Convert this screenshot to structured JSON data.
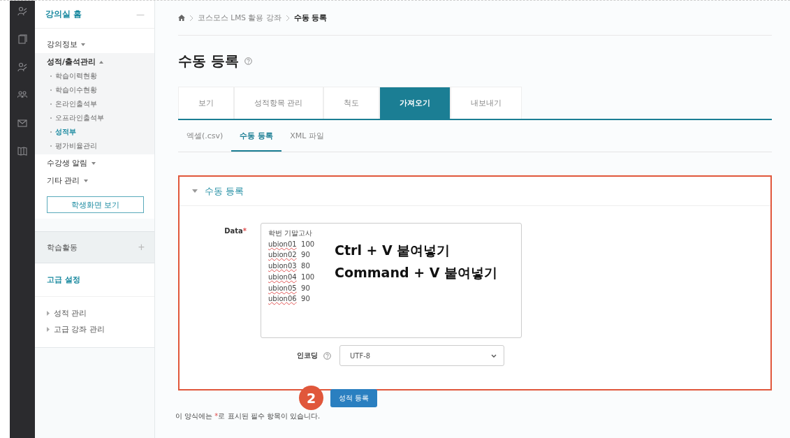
{
  "sidebar": {
    "home": {
      "label": "강의실 홈",
      "collapse_symbol": "—"
    },
    "menu": [
      {
        "label": "강의정보",
        "expanded": false
      },
      {
        "label": "성적/출석관리",
        "expanded": true,
        "children": [
          {
            "label": "학습이력현황",
            "selected": false
          },
          {
            "label": "학습이수현황",
            "selected": false
          },
          {
            "label": "온라인출석부",
            "selected": false
          },
          {
            "label": "오프라인출석부",
            "selected": false
          },
          {
            "label": "성적부",
            "selected": true
          },
          {
            "label": "평가비율관리",
            "selected": false
          }
        ]
      },
      {
        "label": "수강생 알림",
        "expanded": false
      },
      {
        "label": "기타 관리",
        "expanded": false
      }
    ],
    "student_view_button": "학생화면 보기",
    "activity": {
      "label": "학습활동",
      "add_symbol": "+"
    },
    "advanced": {
      "label": "고급 설정",
      "items": [
        "성적 관리",
        "고급 강좌 관리"
      ]
    }
  },
  "breadcrumb": [
    "코스모스 LMS 활용 강좌",
    "수동 등록"
  ],
  "title": "수동 등록",
  "tabs": [
    {
      "label": "보기",
      "selected": false
    },
    {
      "label": "성적항목 관리",
      "selected": false
    },
    {
      "label": "척도",
      "selected": false
    },
    {
      "label": "가져오기",
      "selected": true
    },
    {
      "label": "내보내기",
      "selected": false
    }
  ],
  "subtabs": [
    {
      "label": "엑셀(.csv)",
      "selected": false
    },
    {
      "label": "수동 등록",
      "selected": true
    },
    {
      "label": "XML 파일",
      "selected": false
    }
  ],
  "form": {
    "section_title": "수동 등록",
    "expanded": true,
    "data_label": "Data",
    "required_mark": "*",
    "data_header": "학번 기말고사",
    "data_rows": [
      {
        "id": "ubion01",
        "score": "100"
      },
      {
        "id": "ubion02",
        "score": "90"
      },
      {
        "id": "ubion03",
        "score": "80"
      },
      {
        "id": "ubion04",
        "score": "100"
      },
      {
        "id": "ubion05",
        "score": "90"
      },
      {
        "id": "ubion06",
        "score": "90"
      }
    ],
    "annotation": [
      "Ctrl + V 붙여넣기",
      "Command + V 붙여넣기"
    ],
    "encoding_label": "인코딩",
    "encoding_value": "UTF-8"
  },
  "step_badge": "2",
  "submit_button": "성적 등록",
  "note": {
    "before": "이 양식에는 ",
    "mark": "*",
    "after": "로 표시된 필수 항목이 있습니다."
  }
}
